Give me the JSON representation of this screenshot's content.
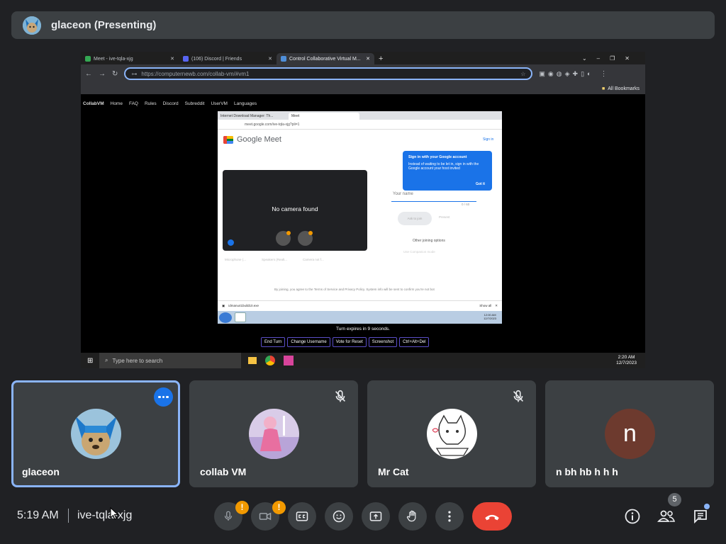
{
  "presenter": {
    "name": "glaceon (Presenting)"
  },
  "shared_screen": {
    "browser_tabs": [
      {
        "label": "Meet - ive-tqla-xjg",
        "color": "#34a853"
      },
      {
        "label": "(106) Discord | Friends",
        "color": "#5865f2"
      },
      {
        "label": "Control Collaborative Virtual M...",
        "color": "#4f8fd9"
      }
    ],
    "url": "https://computernewb.com/collab-vm/#vm1",
    "bookmarks_label": "All Bookmarks",
    "collabvm_nav": [
      "CollabVM",
      "Home",
      "FAQ",
      "Rules",
      "Discord",
      "Subreddit",
      "UserVM",
      "Languages"
    ],
    "vm": {
      "tabs": [
        "Internet Download Manager: Th...",
        "Meet"
      ],
      "url": "meet.google.com/ive-tqla-xjg?pli=1",
      "meet_title": "Google Meet",
      "sign_in": "Sign in",
      "no_camera": "No camera found",
      "pref_items": [
        "Microphone (... ",
        "Speakers (Realt...",
        "Camera not f..."
      ],
      "tooltip_title": "Sign in with your Google account",
      "tooltip_body": "Instead of waiting to be let in, sign in with the Google account your host invited",
      "tooltip_action": "Got it",
      "name_placeholder": "Your name",
      "name_count": "0 / 60",
      "ask_label": "Ask to join",
      "present_label": "Present",
      "other_options": "Other joining options",
      "join_companion": "Use Companion mode",
      "terms": "By joining, you agree to the Terms of Service and Privacy Policy. System info will be sent to confirm you're not bot",
      "download_file": "idmanu41build10.exe",
      "show_all": "Show all",
      "time": "12:00 AM",
      "date": "12/7/2023"
    },
    "turn_text": "Turn expires in 9 seconds.",
    "vm_buttons": [
      "End Turn",
      "Change Username",
      "Vote for Reset",
      "Screenshot",
      "Ctrl+Alt+Del"
    ],
    "taskbar_search": "Type here to search",
    "taskbar_time": "2:20 AM",
    "taskbar_date": "12/7/2023"
  },
  "participants": [
    {
      "name": "glaceon",
      "muted": false,
      "active": true
    },
    {
      "name": "collab VM",
      "muted": true
    },
    {
      "name": "Mr Cat",
      "muted": true
    },
    {
      "name": "n bh hb h h h",
      "initial": "n",
      "avatar_color": "#6d3a2e"
    }
  ],
  "bottom_bar": {
    "time": "5:19 AM",
    "meeting_code": "ive-tqla-xjg",
    "people_count": "5",
    "warning_glyph": "!"
  },
  "colors": {
    "accent": "#8ab4f8",
    "end_call": "#ea4335",
    "warning": "#f29900",
    "tile": "#3c4043",
    "background": "#202124"
  }
}
